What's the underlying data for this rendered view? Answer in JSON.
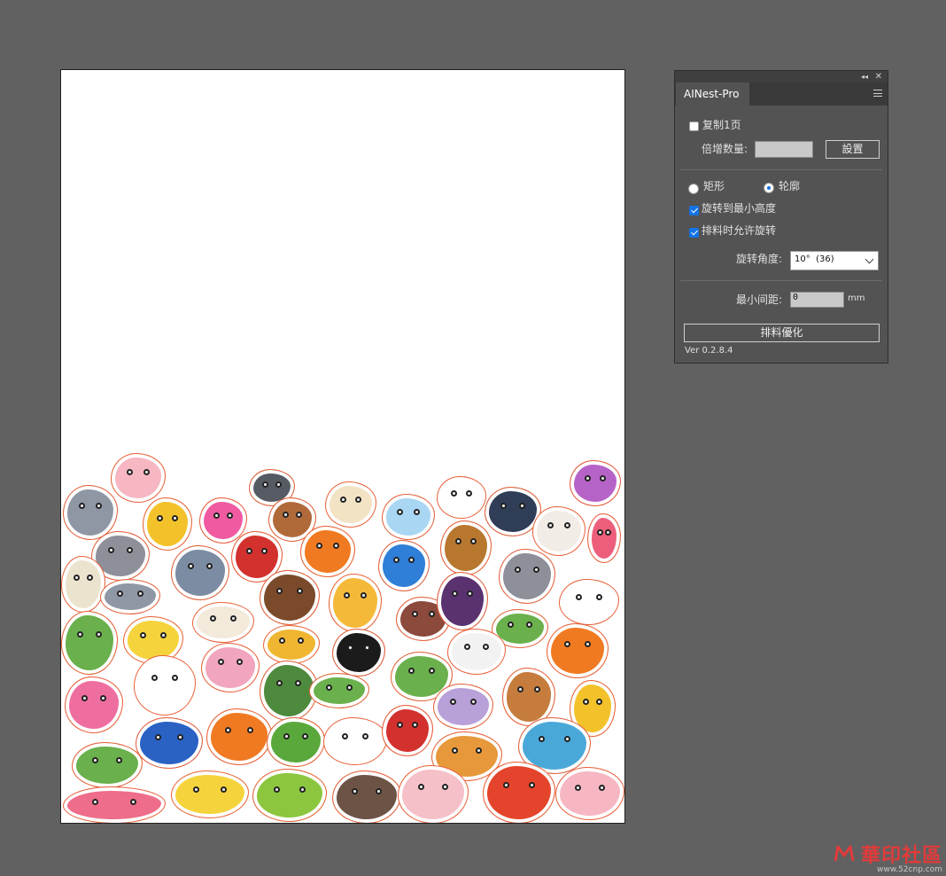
{
  "panel": {
    "tab_label": "AINest-Pro",
    "copy_one_page_label": "复制1页",
    "copy_one_page_checked": false,
    "multiplier_label": "倍增数量:",
    "multiplier_value": "",
    "set_button_label": "設置",
    "mode_rect_label": "矩形",
    "mode_outline_label": "轮廓",
    "mode_selected": "轮廓",
    "rotate_min_height_label": "旋转到最小高度",
    "rotate_min_height_checked": true,
    "allow_rotation_label": "排料时允许旋转",
    "allow_rotation_checked": true,
    "rotation_angle_label": "旋转角度:",
    "rotation_angle_value": "10°  (36)",
    "min_spacing_label": "最小间距:",
    "min_spacing_value": "0",
    "min_spacing_unit": "mm",
    "optimize_button_label": "排料優化",
    "version": "Ver  0.2.8.4"
  },
  "watermark": {
    "text": "華印社區",
    "url": "www.52cnp.com"
  },
  "colors": {
    "workspace": "#616161",
    "panel_bg": "#535353",
    "accent": "#1473e6",
    "cut_line": "#e8613a"
  },
  "icons": [
    "collapse-icon",
    "close-icon",
    "panel-menu-icon",
    "chevron-down-icon"
  ]
}
